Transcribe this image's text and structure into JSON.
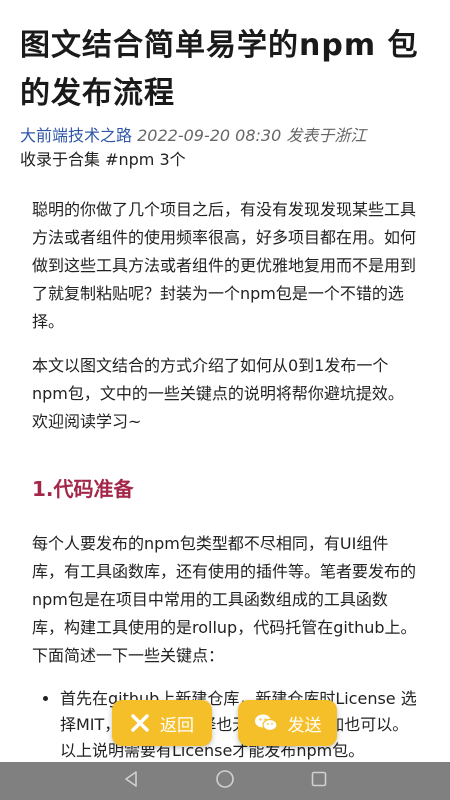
{
  "article": {
    "title": "图文结合简单易学的npm 包的发布流程",
    "author": "大前端技术之路",
    "date_location": "2022-09-20 08:30 发表于浙江",
    "collection": "收录于合集 #npm 3个"
  },
  "content": {
    "paragraphs": [
      "聪明的你做了几个项目之后，有没有发现发现某些工具方法或者组件的使用频率很高，好多项目都在用。如何做到这些工具方法或者组件的更优雅地复用而不是用到了就复制粘贴呢？封装为一个npm包是一个不错的选择。",
      "本文以图文结合的方式介绍了如何从0到1发布一个npm包，文中的一些关键点的说明将帮你避坑提效。欢迎阅读学习~"
    ],
    "section_title": "1.代码准备",
    "section_para": "每个人要发布的npm包类型都不尽相同，有UI组件库，有工具函数库，还有使用的插件等。笔者要发布的npm包是在项目中常用的工具函数组成的工具函数库，构建工具使用的是rollup，代码托管在github上。下面简述一下一些关键点：",
    "bullets": [
      "首先在github上新建仓库，新建仓库时License 选择MIT，此步骤不选择也无妨，后续添加也可以。以上说明需要有License才能发布npm包。"
    ]
  },
  "floating": {
    "back_label": "返回",
    "send_label": "发送"
  },
  "icons": {
    "back": "close-x-icon",
    "send": "wechat-icon",
    "nav_back": "triangle-back-icon",
    "nav_home": "circle-home-icon",
    "nav_recent": "square-recent-icon"
  },
  "colors": {
    "author": "#2f57a8",
    "section_title": "#a4274a",
    "floating_button": "#f5bf2a",
    "nav_bar": "#808080"
  }
}
